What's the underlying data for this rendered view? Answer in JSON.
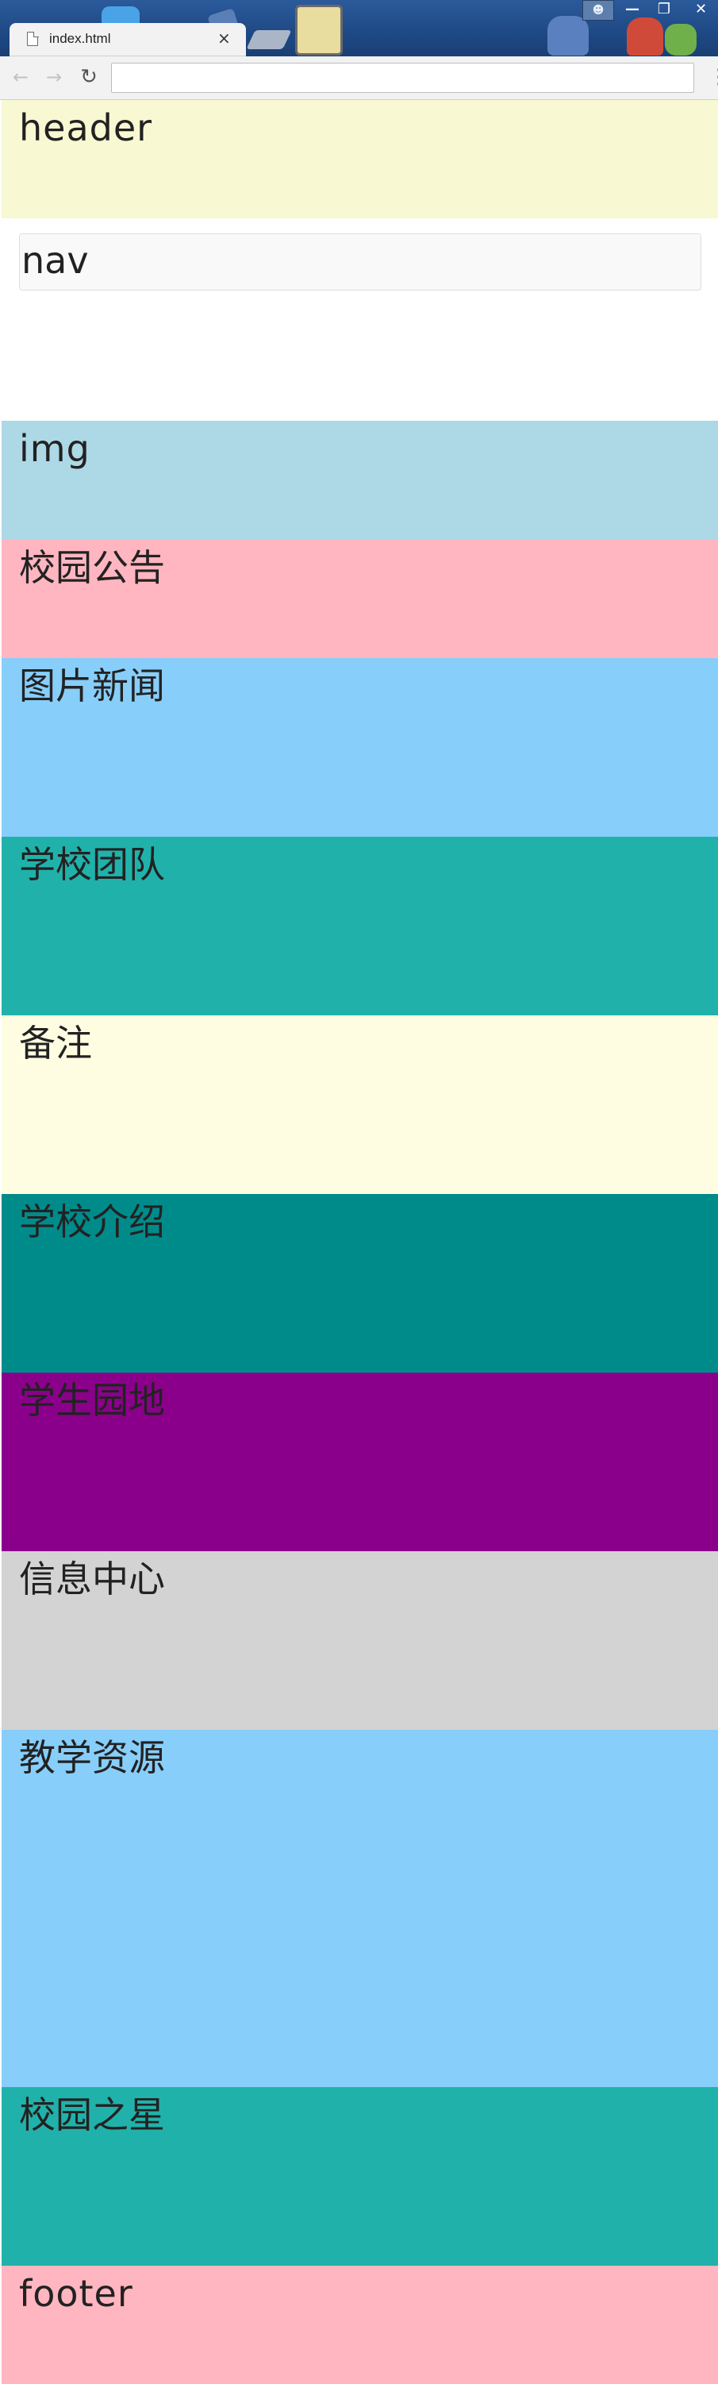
{
  "browser": {
    "tab_title": "index.html",
    "tab_close": "×",
    "address_value": "",
    "icons": [
      "file-icon",
      "back-arrow-icon",
      "forward-arrow-icon",
      "reload-icon",
      "menu-dots-icon",
      "close-icon"
    ]
  },
  "page": {
    "sections": [
      {
        "label": "header",
        "color": "#F8F8D2"
      },
      {
        "label": "nav",
        "color": "#FFFFFF"
      },
      {
        "label": "img",
        "color": "#ADD8E6"
      },
      {
        "label": "校园公告",
        "color": "#FFB6C1"
      },
      {
        "label": "图片新闻",
        "color": "#87CEFA"
      },
      {
        "label": "学校团队",
        "color": "#20B2AA"
      },
      {
        "label": "备注",
        "color": "#FFFDE1"
      },
      {
        "label": "学校介绍",
        "color": "#008B8B"
      },
      {
        "label": "学生园地",
        "color": "#8B008B"
      },
      {
        "label": "信息中心",
        "color": "#D3D3D3"
      },
      {
        "label": "教学资源",
        "color": "#87CEFA"
      },
      {
        "label": "校园之星",
        "color": "#20B2AA"
      },
      {
        "label": "footer",
        "color": "#FFB6C1"
      }
    ]
  }
}
